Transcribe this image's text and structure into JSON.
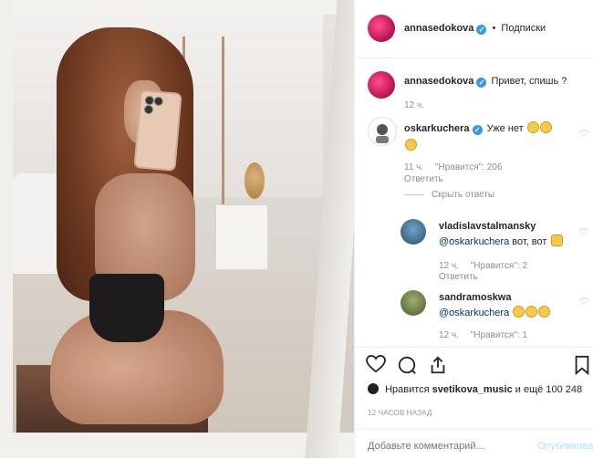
{
  "post": {
    "author": "annasedokova",
    "follow_label": "Подписки",
    "separator": "•",
    "caption": "Привет, спишь ?",
    "caption_time": "12 ч.",
    "likes_text_prefix": "Нравится",
    "likes_user": "svetikova_music",
    "likes_text_suffix": "и ещё 100 248",
    "timestamp": "12 ЧАСОВ НАЗАД"
  },
  "comments": [
    {
      "user": "oskarkuchera",
      "text": "Уже нет",
      "time": "11 ч.",
      "likes": "\"Нравится\": 206",
      "reply": "Ответить",
      "toggle_replies": "Скрыть ответы"
    }
  ],
  "replies": [
    {
      "user": "vladislavstalmansky",
      "mention": "@oskarkuchera",
      "text": "вот, вот",
      "time": "12 ч.",
      "likes": "\"Нравится\": 2",
      "reply": "Ответить"
    },
    {
      "user": "sandramoskwa",
      "mention": "@oskarkuchera",
      "time": "12 ч.",
      "likes": "\"Нравится\": 1"
    }
  ],
  "comment_box": {
    "placeholder": "Добавьте комментарий...",
    "publish_label": "Опубликовать"
  },
  "colors": {
    "verified": "#3897f0",
    "link": "#003569",
    "publish_disabled": "#b2dffc"
  }
}
